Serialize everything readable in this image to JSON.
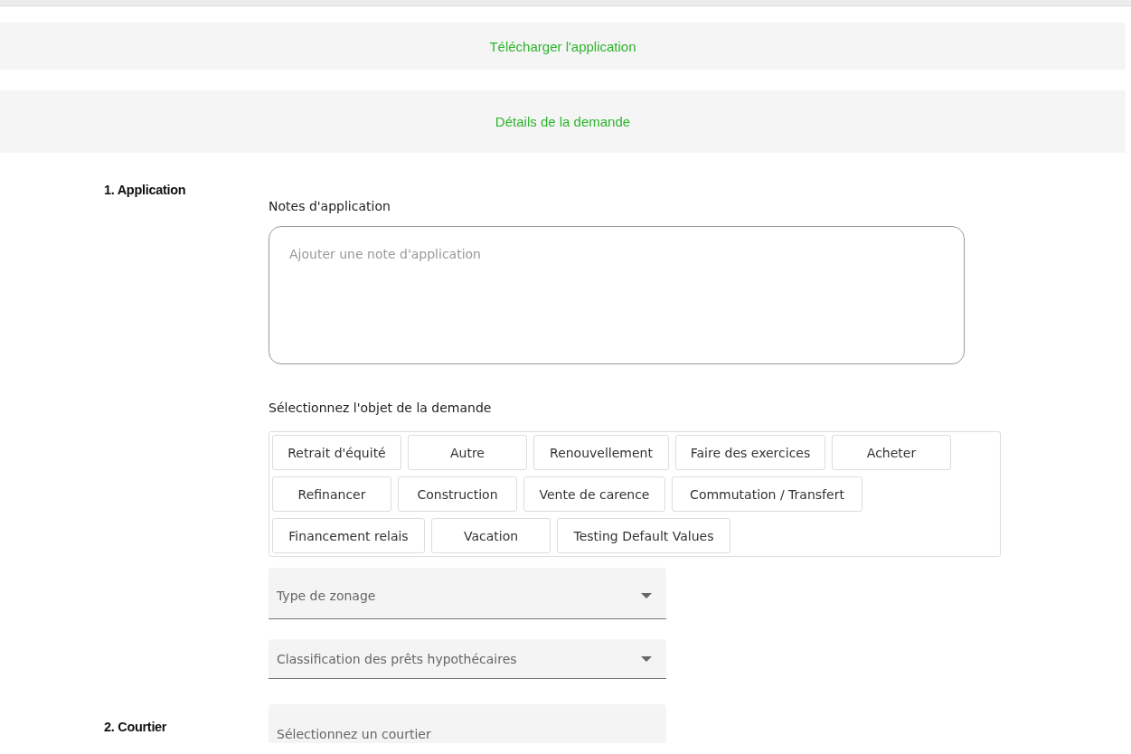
{
  "banners": [
    {
      "label": "Télécharger l'application"
    },
    {
      "label": "Détails de la demande"
    }
  ],
  "sections": [
    {
      "title": "1. Application",
      "notes_label": "Notes d'application",
      "notes_placeholder": "Ajouter une note d'application",
      "purpose_label": "Sélectionnez l'objet de la demande",
      "purposes": [
        {
          "label": "Retrait d'équité"
        },
        {
          "label": "Autre"
        },
        {
          "label": "Renouvellement"
        },
        {
          "label": "Faire des exercices"
        },
        {
          "label": "Acheter"
        },
        {
          "label": "Refinancer"
        },
        {
          "label": "Construction"
        },
        {
          "label": "Vente de carence"
        },
        {
          "label": "Commutation / Transfert"
        },
        {
          "label": "Financement relais"
        },
        {
          "label": "Vacation"
        },
        {
          "label": "Testing Default Values"
        }
      ],
      "selects": [
        {
          "placeholder": "Type de zonage"
        },
        {
          "placeholder": "Classification des prêts hypothécaires"
        }
      ]
    },
    {
      "title": "2. Courtier",
      "broker_placeholder": "Sélectionnez un courtier"
    }
  ]
}
